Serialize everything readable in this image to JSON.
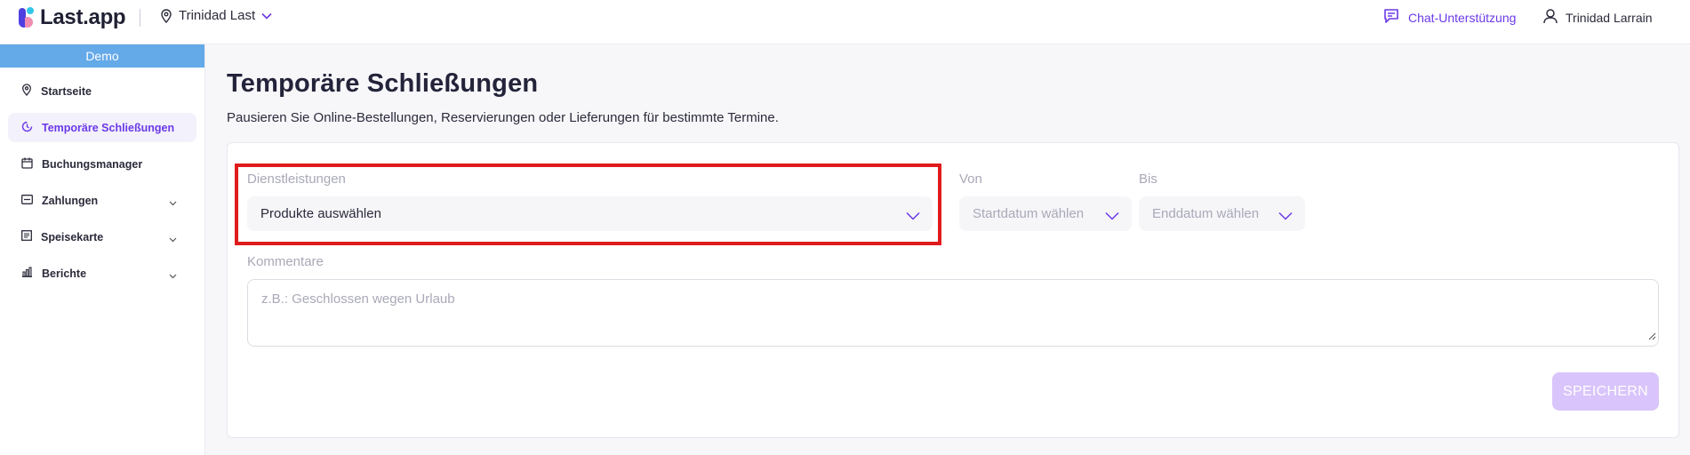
{
  "app": {
    "logo_text": "Last.app",
    "location": "Trinidad Last",
    "chat_label": "Chat-Unterstützung",
    "user_name": "Trinidad Larrain"
  },
  "sidebar": {
    "banner": "Demo",
    "items": [
      {
        "label": "Startseite",
        "icon": "location-pin-icon",
        "active": false,
        "expandable": false
      },
      {
        "label": "Temporäre Schließungen",
        "icon": "pause-clock-icon",
        "active": true,
        "expandable": false
      },
      {
        "label": "Buchungsmanager",
        "icon": "calendar-icon",
        "active": false,
        "expandable": false
      },
      {
        "label": "Zahlungen",
        "icon": "credit-card-icon",
        "active": false,
        "expandable": true
      },
      {
        "label": "Speisekarte",
        "icon": "menu-book-icon",
        "active": false,
        "expandable": true
      },
      {
        "label": "Berichte",
        "icon": "bar-chart-icon",
        "active": false,
        "expandable": true
      }
    ]
  },
  "main": {
    "title": "Temporäre Schließungen",
    "subtitle": "Pausieren Sie Online-Bestellungen, Reservierungen oder Lieferungen für bestimmte Termine.",
    "form": {
      "services_label": "Dienstleistungen",
      "services_value": "Produkte auswählen",
      "from_label": "Von",
      "from_placeholder": "Startdatum wählen",
      "to_label": "Bis",
      "to_placeholder": "Enddatum wählen",
      "comment_label": "Kommentare",
      "comment_placeholder": "z.B.: Geschlossen wegen Urlaub",
      "save_label": "SPEICHERN"
    }
  },
  "colors": {
    "accent": "#6b39e8",
    "highlight_border": "#e01b1b",
    "demo_banner": "#64a9e8",
    "save_disabled": "#d9c4fb"
  }
}
